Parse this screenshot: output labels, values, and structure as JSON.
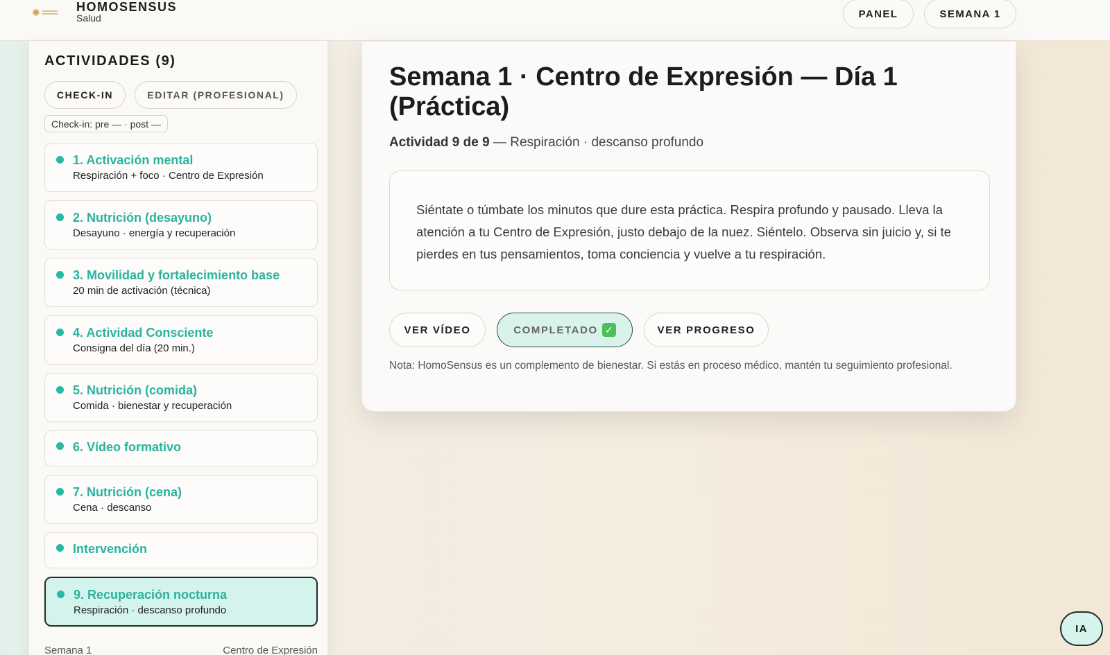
{
  "header": {
    "brand_name": "HOMOSENSUS",
    "brand_sub": "Salud",
    "nav": [
      "PANEL",
      "SEMANA 1"
    ]
  },
  "sidebar": {
    "title": "ACTIVIDADES (9)",
    "buttons": [
      "CHECK-IN",
      "EDITAR (PROFESIONAL)"
    ],
    "checkin_status": "Check-in: pre — · post —",
    "activities": [
      {
        "title": "1. Activación mental",
        "subtitle": "Respiración + foco · Centro de Expresión"
      },
      {
        "title": "2. Nutrición (desayuno)",
        "subtitle": "Desayuno · energía y recuperación"
      },
      {
        "title": "3. Movilidad y fortalecimiento base",
        "subtitle": "20 min de activación (técnica)"
      },
      {
        "title": "4. Actividad Consciente",
        "subtitle": "Consigna del día (20 min.)"
      },
      {
        "title": "5. Nutrición (comida)",
        "subtitle": "Comida · bienestar y recuperación"
      },
      {
        "title": "6. Vídeo formativo",
        "subtitle": ""
      },
      {
        "title": "7. Nutrición (cena)",
        "subtitle": "Cena · descanso"
      },
      {
        "title": "Intervención",
        "subtitle": ""
      },
      {
        "title": "9. Recuperación nocturna",
        "subtitle": "Respiración · descanso profundo",
        "active": true
      }
    ],
    "footer_left": "Semana 1",
    "footer_right": "Centro de Expresión"
  },
  "main": {
    "title": "Semana 1 · Centro de Expresión — Día 1 (Práctica)",
    "subtitle_bold": "Actividad 9 de 9",
    "subtitle_rest": " — Respiración · descanso profundo",
    "instructions": "Siéntate o túmbate los minutos que dure esta práctica. Respira profundo y pausado. Lleva la atención a tu Centro de Expresión, justo debajo de la nuez. Siéntelo. Observa sin juicio y, si te pierdes en tus pensamientos, toma conciencia y vuelve a tu respiración.",
    "buttons": {
      "video": "VER VÍDEO",
      "completed": "COMPLETADO",
      "progress": "VER PROGRESO"
    },
    "note": "Nota: HomoSensus es un complemento de bienestar. Si estás en proceso médico, mantén tu seguimiento profesional."
  },
  "ia_button": "IA",
  "colors": {
    "accent": "#29b39e",
    "active_bg": "#d4f3ec",
    "check": "#4cbf5a"
  }
}
